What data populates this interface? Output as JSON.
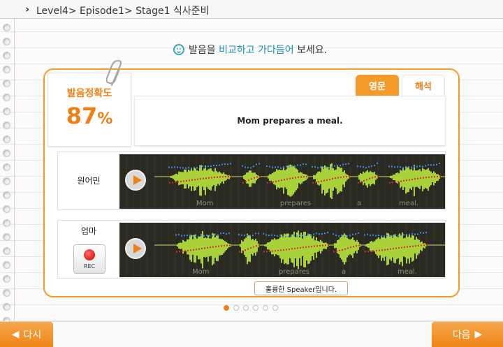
{
  "header": {
    "breadcrumb": "Level4> Episode1> Stage1 식사준비"
  },
  "instruction": {
    "prefix": "발음을 ",
    "highlight": "비교하고 가다듬어",
    "suffix": " 보세요."
  },
  "score": {
    "label": "발음정확도",
    "value": "87",
    "unit": "%"
  },
  "tabs": [
    {
      "label": "영문",
      "active": true
    },
    {
      "label": "해석",
      "active": false
    }
  ],
  "sentence": "Mom prepares a meal.",
  "native": {
    "label": "원어민",
    "words": [
      "Mom",
      "prepares",
      "a",
      "meal."
    ]
  },
  "user": {
    "label": "엄마",
    "rec_label": "REC",
    "words": [
      "Mom",
      "prepares",
      "a",
      "meal."
    ]
  },
  "feedback": "훌륭한 Speaker입니다.",
  "pagination": {
    "total": 6,
    "current": 1
  },
  "nav": {
    "prev_label": "다시",
    "next_label": "다음"
  },
  "colors": {
    "accent": "#f39a2b",
    "wave": "#a8d13a",
    "pitch_blue": "#3d8de6",
    "pitch_red": "#e02a2a",
    "wave_bg": "#2b2a22"
  }
}
